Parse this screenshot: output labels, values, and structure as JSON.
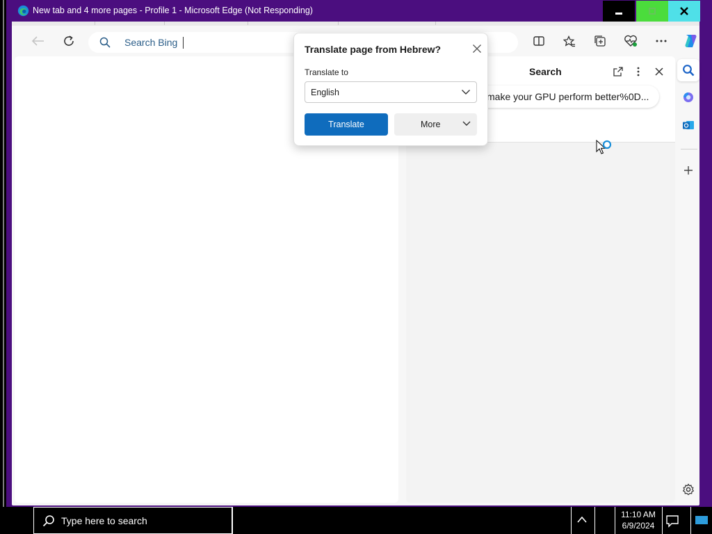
{
  "window": {
    "title": "New tab and 4 more pages - Profile 1 - Microsoft Edge (Not Responding)",
    "minimize_icon": "minimize-icon",
    "maximize_icon": "maximize-icon",
    "close_icon": "close-icon"
  },
  "toolbar": {
    "address_text": "Search Bing",
    "icons": [
      "back-icon",
      "refresh-icon",
      "split-screen-icon",
      "favorites-icon",
      "collections-icon",
      "browser-essentials-icon",
      "more-icon",
      "copilot-icon"
    ]
  },
  "translate_popup": {
    "title": "Translate page from Hebrew?",
    "label": "Translate to",
    "selected_language": "English",
    "translate_button": "Translate",
    "more_button": "More"
  },
  "side_pane": {
    "title": "Search",
    "query": "make your GPU perform better%0D..."
  },
  "rail": {
    "items": [
      "search-icon",
      "copilot-icon",
      "outlook-icon",
      "add-icon",
      "settings-icon"
    ]
  },
  "taskbar": {
    "search_placeholder": "Type here to search",
    "time": "11:10 AM",
    "date": "6/9/2024"
  },
  "colors": {
    "title_bar": "#4b0e7f",
    "accent": "#0f6cbd",
    "maximize_button": "#4bdc3c",
    "close_button": "#4fe0e8"
  }
}
